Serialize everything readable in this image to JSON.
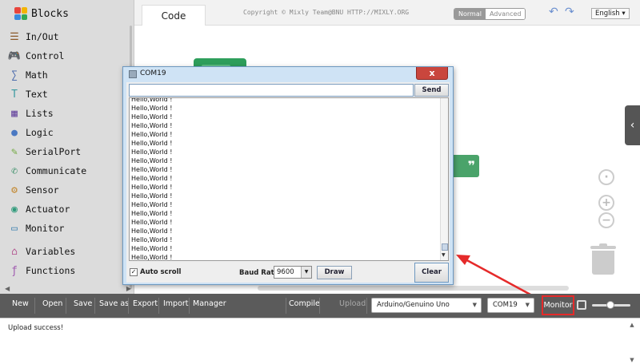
{
  "sidebar": {
    "title": "Blocks",
    "categories": [
      {
        "label": "In/Out",
        "icon": "inout-icon",
        "color": "#8b5a2b"
      },
      {
        "label": "Control",
        "icon": "gamepad-icon",
        "color": "#3a8f4a"
      },
      {
        "label": "Math",
        "icon": "math-icon",
        "color": "#3b5ea8"
      },
      {
        "label": "Text",
        "icon": "text-icon",
        "color": "#3b9aa0"
      },
      {
        "label": "Lists",
        "icon": "lists-icon",
        "color": "#6a4aa0"
      },
      {
        "label": "Logic",
        "icon": "bulb-icon",
        "color": "#4a78c2"
      },
      {
        "label": "SerialPort",
        "icon": "serial-icon",
        "color": "#6fa83c"
      },
      {
        "label": "Communicate",
        "icon": "communicate-icon",
        "color": "#2e8a5f"
      },
      {
        "label": "Sensor",
        "icon": "sensor-icon",
        "color": "#c2872e"
      },
      {
        "label": "Actuator",
        "icon": "actuator-icon",
        "color": "#2e9a7a"
      },
      {
        "label": "Monitor",
        "icon": "monitor-icon",
        "color": "#3a7fb0"
      },
      {
        "label": "Variables",
        "icon": "variables-icon",
        "color": "#b04a8a"
      },
      {
        "label": "Functions",
        "icon": "functions-icon",
        "color": "#a05ab0"
      }
    ]
  },
  "topbar": {
    "tab_code": "Code",
    "copyright": "Copyright © Mixly Team@BNU HTTP://MIXLY.ORG",
    "mode_normal": "Normal",
    "mode_advanced": "Advanced",
    "language": "English"
  },
  "serial_monitor": {
    "title": "COM19",
    "close_label": "x",
    "input_value": "",
    "send_label": "Send",
    "log_lines": [
      "Hello,World !",
      "Hello,World !",
      "Hello,World !",
      "Hello,World !",
      "Hello,World !",
      "Hello,World !",
      "Hello,World !",
      "Hello,World !",
      "Hello,World !",
      "Hello,World !",
      "Hello,World !",
      "Hello,World !",
      "Hello,World !",
      "Hello,World !",
      "Hello,World !",
      "Hello,World !",
      "Hello,World !",
      "Hello,World !",
      "Hello,World !",
      "Hello,Wor"
    ],
    "autoscroll_label": "Auto scroll",
    "autoscroll_checked": true,
    "baud_label": "Baud Rate",
    "baud_value": "9600",
    "draw_label": "Draw",
    "clear_label": "Clear"
  },
  "toolbar": {
    "new_label": "New",
    "open_label": "Open",
    "save_label": "Save",
    "save_as_label": "Save as",
    "export_label": "Export",
    "import_label": "Import",
    "manager_label": "Manager",
    "compile_label": "Compile",
    "upload_label": "Upload",
    "board_value": "Arduino/Genuino Uno",
    "port_value": "COM19",
    "monitor_label": "Monitor"
  },
  "output": {
    "message": "Upload success!"
  },
  "colors": {
    "toolbar_bg": "#5b5b5b",
    "highlight_red": "#e52a2a",
    "sidebar_bg": "#dcdcdc",
    "block_green": "#2e9e5b"
  }
}
